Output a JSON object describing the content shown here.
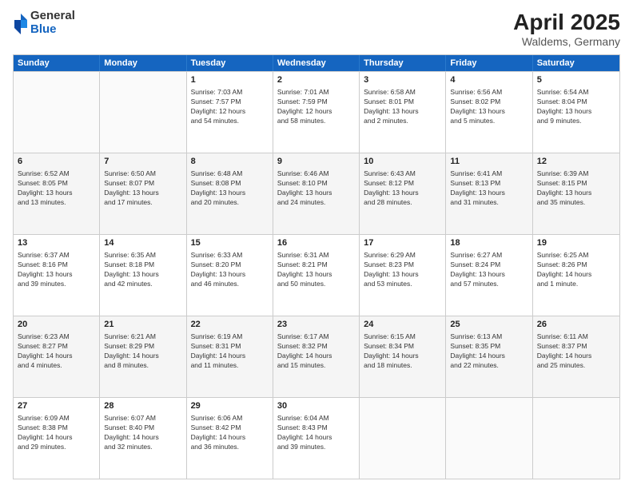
{
  "logo": {
    "general": "General",
    "blue": "Blue"
  },
  "title": "April 2025",
  "subtitle": "Waldems, Germany",
  "days": [
    "Sunday",
    "Monday",
    "Tuesday",
    "Wednesday",
    "Thursday",
    "Friday",
    "Saturday"
  ],
  "rows": [
    [
      {
        "day": "",
        "info": ""
      },
      {
        "day": "",
        "info": ""
      },
      {
        "day": "1",
        "info": "Sunrise: 7:03 AM\nSunset: 7:57 PM\nDaylight: 12 hours\nand 54 minutes."
      },
      {
        "day": "2",
        "info": "Sunrise: 7:01 AM\nSunset: 7:59 PM\nDaylight: 12 hours\nand 58 minutes."
      },
      {
        "day": "3",
        "info": "Sunrise: 6:58 AM\nSunset: 8:01 PM\nDaylight: 13 hours\nand 2 minutes."
      },
      {
        "day": "4",
        "info": "Sunrise: 6:56 AM\nSunset: 8:02 PM\nDaylight: 13 hours\nand 5 minutes."
      },
      {
        "day": "5",
        "info": "Sunrise: 6:54 AM\nSunset: 8:04 PM\nDaylight: 13 hours\nand 9 minutes."
      }
    ],
    [
      {
        "day": "6",
        "info": "Sunrise: 6:52 AM\nSunset: 8:05 PM\nDaylight: 13 hours\nand 13 minutes."
      },
      {
        "day": "7",
        "info": "Sunrise: 6:50 AM\nSunset: 8:07 PM\nDaylight: 13 hours\nand 17 minutes."
      },
      {
        "day": "8",
        "info": "Sunrise: 6:48 AM\nSunset: 8:08 PM\nDaylight: 13 hours\nand 20 minutes."
      },
      {
        "day": "9",
        "info": "Sunrise: 6:46 AM\nSunset: 8:10 PM\nDaylight: 13 hours\nand 24 minutes."
      },
      {
        "day": "10",
        "info": "Sunrise: 6:43 AM\nSunset: 8:12 PM\nDaylight: 13 hours\nand 28 minutes."
      },
      {
        "day": "11",
        "info": "Sunrise: 6:41 AM\nSunset: 8:13 PM\nDaylight: 13 hours\nand 31 minutes."
      },
      {
        "day": "12",
        "info": "Sunrise: 6:39 AM\nSunset: 8:15 PM\nDaylight: 13 hours\nand 35 minutes."
      }
    ],
    [
      {
        "day": "13",
        "info": "Sunrise: 6:37 AM\nSunset: 8:16 PM\nDaylight: 13 hours\nand 39 minutes."
      },
      {
        "day": "14",
        "info": "Sunrise: 6:35 AM\nSunset: 8:18 PM\nDaylight: 13 hours\nand 42 minutes."
      },
      {
        "day": "15",
        "info": "Sunrise: 6:33 AM\nSunset: 8:20 PM\nDaylight: 13 hours\nand 46 minutes."
      },
      {
        "day": "16",
        "info": "Sunrise: 6:31 AM\nSunset: 8:21 PM\nDaylight: 13 hours\nand 50 minutes."
      },
      {
        "day": "17",
        "info": "Sunrise: 6:29 AM\nSunset: 8:23 PM\nDaylight: 13 hours\nand 53 minutes."
      },
      {
        "day": "18",
        "info": "Sunrise: 6:27 AM\nSunset: 8:24 PM\nDaylight: 13 hours\nand 57 minutes."
      },
      {
        "day": "19",
        "info": "Sunrise: 6:25 AM\nSunset: 8:26 PM\nDaylight: 14 hours\nand 1 minute."
      }
    ],
    [
      {
        "day": "20",
        "info": "Sunrise: 6:23 AM\nSunset: 8:27 PM\nDaylight: 14 hours\nand 4 minutes."
      },
      {
        "day": "21",
        "info": "Sunrise: 6:21 AM\nSunset: 8:29 PM\nDaylight: 14 hours\nand 8 minutes."
      },
      {
        "day": "22",
        "info": "Sunrise: 6:19 AM\nSunset: 8:31 PM\nDaylight: 14 hours\nand 11 minutes."
      },
      {
        "day": "23",
        "info": "Sunrise: 6:17 AM\nSunset: 8:32 PM\nDaylight: 14 hours\nand 15 minutes."
      },
      {
        "day": "24",
        "info": "Sunrise: 6:15 AM\nSunset: 8:34 PM\nDaylight: 14 hours\nand 18 minutes."
      },
      {
        "day": "25",
        "info": "Sunrise: 6:13 AM\nSunset: 8:35 PM\nDaylight: 14 hours\nand 22 minutes."
      },
      {
        "day": "26",
        "info": "Sunrise: 6:11 AM\nSunset: 8:37 PM\nDaylight: 14 hours\nand 25 minutes."
      }
    ],
    [
      {
        "day": "27",
        "info": "Sunrise: 6:09 AM\nSunset: 8:38 PM\nDaylight: 14 hours\nand 29 minutes."
      },
      {
        "day": "28",
        "info": "Sunrise: 6:07 AM\nSunset: 8:40 PM\nDaylight: 14 hours\nand 32 minutes."
      },
      {
        "day": "29",
        "info": "Sunrise: 6:06 AM\nSunset: 8:42 PM\nDaylight: 14 hours\nand 36 minutes."
      },
      {
        "day": "30",
        "info": "Sunrise: 6:04 AM\nSunset: 8:43 PM\nDaylight: 14 hours\nand 39 minutes."
      },
      {
        "day": "",
        "info": ""
      },
      {
        "day": "",
        "info": ""
      },
      {
        "day": "",
        "info": ""
      }
    ]
  ]
}
